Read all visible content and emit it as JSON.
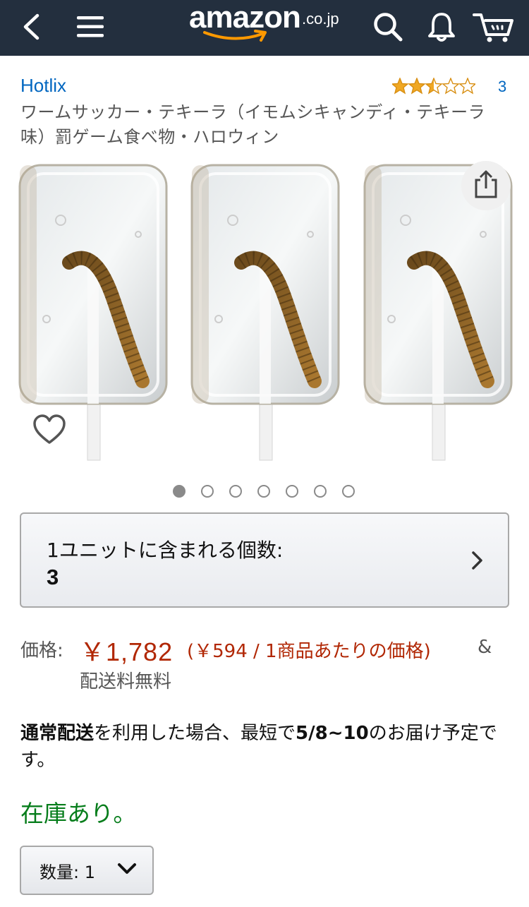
{
  "nav": {
    "logo_text": "amazon",
    "logo_tld": ".co.jp",
    "icons": [
      "back-icon",
      "menu-icon",
      "search-icon",
      "bell-icon",
      "cart-icon"
    ]
  },
  "product": {
    "brand": "Hotlix",
    "rating_stars": 2.5,
    "rating_count": "3",
    "title": "ワームサッカー・テキーラ（イモムシキャンディ・テキーラ味）罰ゲーム食べ物・ハロウィン"
  },
  "gallery": {
    "image_count": 7,
    "active_index": 0
  },
  "unit": {
    "label": "1ユニットに含まれる個数:",
    "value": "3"
  },
  "price": {
    "label": "価格:",
    "main": "￥1,782",
    "per_unit": "(￥594 / 1商品あたりの価格)",
    "amp": "&",
    "shipping": "配送料無料"
  },
  "delivery": {
    "bold1": "通常配送",
    "text1": "を利用した場合、最短で",
    "bold2": "5/8~10",
    "text2": "のお届け予定です。"
  },
  "stock": "在庫あり。",
  "quantity": {
    "label": "数量:",
    "value": "1"
  },
  "colors": {
    "nav_bg": "#232f3e",
    "link": "#0066c0",
    "price": "#b12704",
    "in_stock": "#067d1b",
    "star": "#f0a824"
  }
}
